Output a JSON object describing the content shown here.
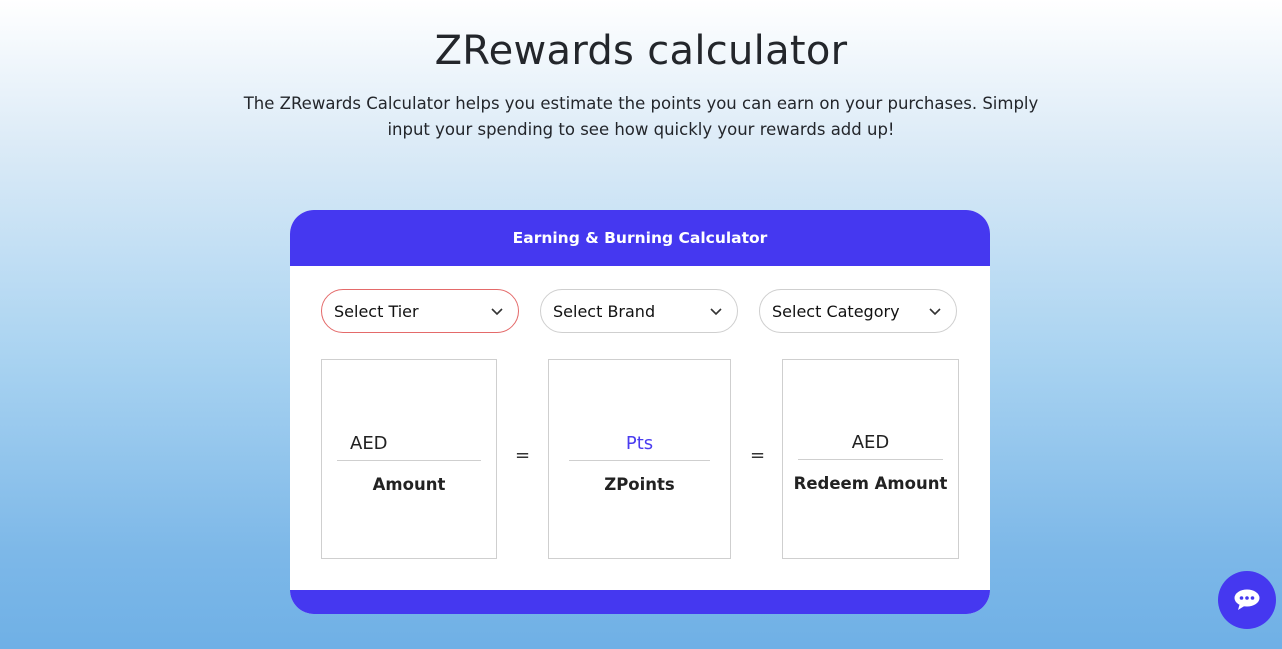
{
  "page": {
    "title": "ZRewards calculator",
    "description": "The ZRewards Calculator helps you estimate the points you can earn on your purchases. Simply input your spending to see how quickly your rewards add up!"
  },
  "calculator": {
    "title": "Earning & Burning Calculator",
    "selects": [
      {
        "label": "Select Tier",
        "icon": "chevron-down-icon",
        "active": true
      },
      {
        "label": "Select Brand",
        "icon": "chevron-down-icon",
        "active": false
      },
      {
        "label": "Select Category",
        "icon": "chevron-down-icon",
        "active": false
      }
    ],
    "fields": [
      {
        "placeholder": "AED",
        "value": "",
        "label": "Amount"
      },
      {
        "placeholder": "Pts",
        "value": "",
        "label": "ZPoints"
      },
      {
        "placeholder": "AED",
        "value": "",
        "label": "Redeem Amount"
      }
    ],
    "equals": [
      "=",
      "="
    ]
  },
  "colors": {
    "accent": "#4538f0",
    "active_select_border": "#e46a6a",
    "pts_placeholder": "#4a3cf0"
  },
  "chat": {
    "icon": "chat-bubble-icon"
  }
}
